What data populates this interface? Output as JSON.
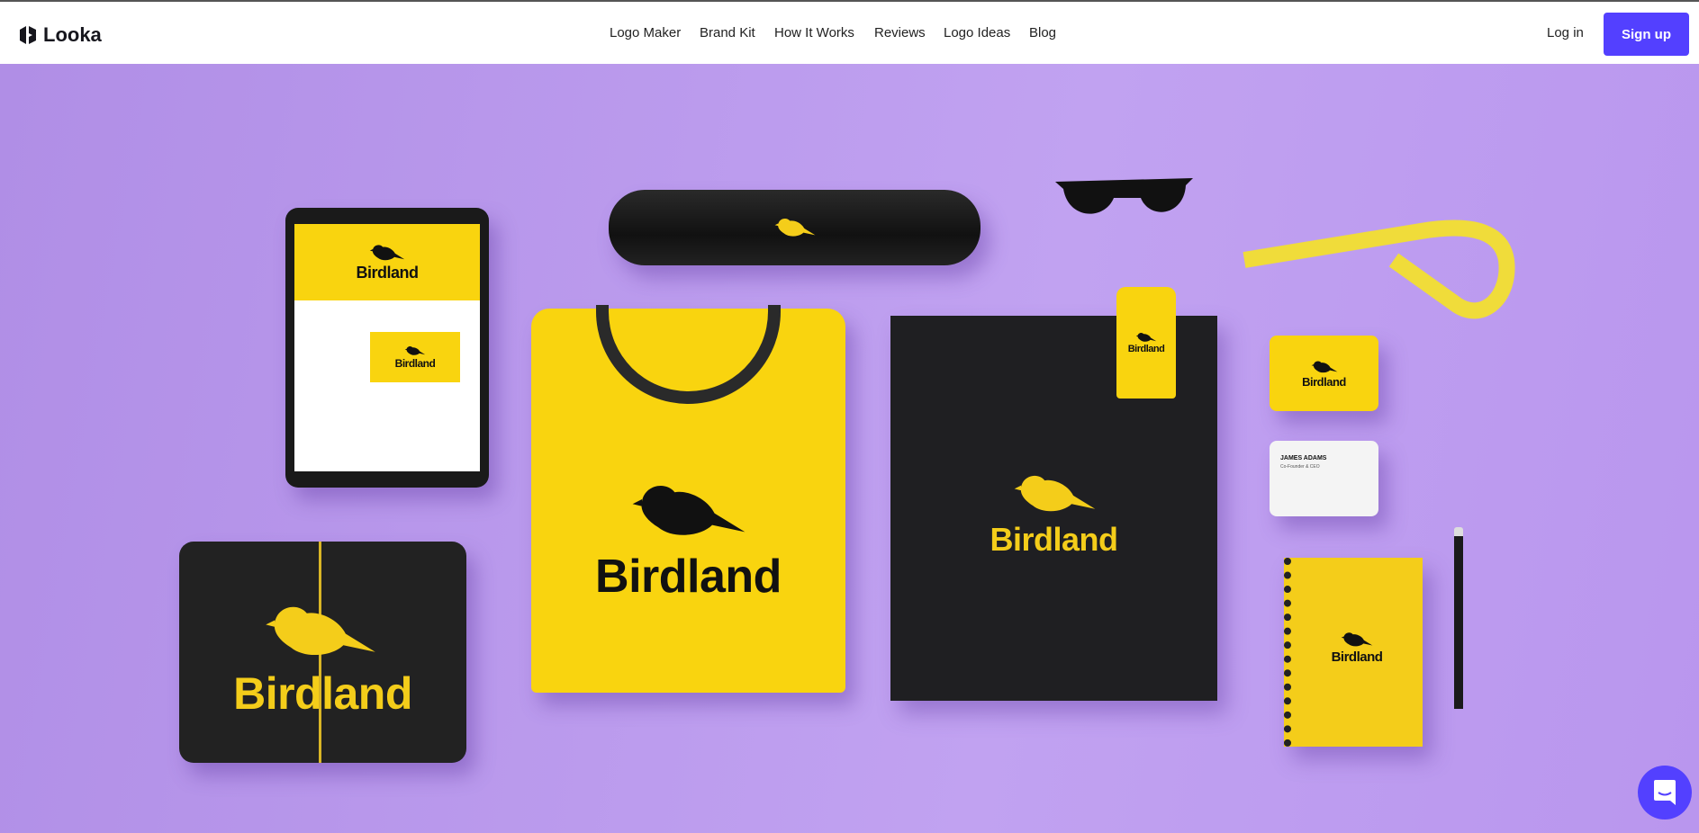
{
  "header": {
    "brand": "Looka",
    "nav": [
      "Logo Maker",
      "Brand Kit",
      "How It Works",
      "Reviews",
      "Logo Ideas",
      "Blog"
    ],
    "login_label": "Log in",
    "signup_label": "Sign up"
  },
  "hero": {
    "brand_name": "Birdland",
    "business_card": {
      "name": "JAMES ADAMS",
      "title": "Co-Founder & CEO"
    },
    "colors": {
      "background": "#b99af0",
      "yellow": "#f9d40f",
      "black": "#1c1c1e",
      "accent": "#5340ff"
    }
  },
  "chat": {
    "icon": "chat-bubble-icon"
  }
}
